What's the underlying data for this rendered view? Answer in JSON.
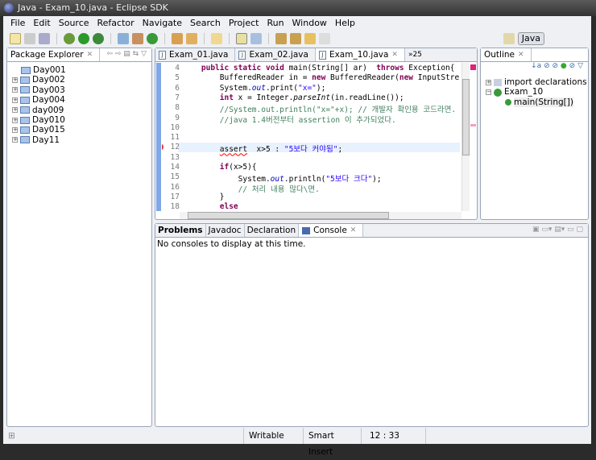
{
  "window": {
    "title": "Java - Exam_10.java - Eclipse SDK"
  },
  "menu": [
    "File",
    "Edit",
    "Source",
    "Refactor",
    "Navigate",
    "Search",
    "Project",
    "Run",
    "Window",
    "Help"
  ],
  "perspective": {
    "label": "Java"
  },
  "package_explorer": {
    "title": "Package Explorer",
    "items": [
      "Day001",
      "Day002",
      "Day003",
      "Day004",
      "day009",
      "Day010",
      "Day015",
      "Day11"
    ]
  },
  "editor": {
    "tabs": [
      "Exam_01.java",
      "Exam_02.java",
      "Exam_10.java"
    ],
    "active_tab": "Exam_10.java",
    "overflow": "»25",
    "lines": [
      {
        "n": "4",
        "html": "    <span class='kw'>public static void</span> main(String[] ar)  <span class='kw'>throws</span> Exception{"
      },
      {
        "n": "5",
        "html": "        BufferedReader in = <span class='kw'>new</span> BufferedReader(<span class='kw'>new</span> InputStre"
      },
      {
        "n": "6",
        "html": "        System.<span class='fd'>out</span>.print(<span class='st'>\"x=\"</span>);"
      },
      {
        "n": "7",
        "html": "        <span class='kw'>int</span> x = Integer.<i>parseInt</i>(in.readLine());"
      },
      {
        "n": "8",
        "html": "        <span class='cm'>//System.out.println(\"x=\"+x); // 개발자 확인용 코드라면.</span>"
      },
      {
        "n": "9",
        "html": "        <span class='cm'>//java 1.4버전부터 assertion 이 추가되었다.</span>"
      },
      {
        "n": "10",
        "html": ""
      },
      {
        "n": "11",
        "html": ""
      },
      {
        "n": "12",
        "html": "        <u style='text-decoration-color:red;text-decoration-style:wavy'>assert</u>  x&gt;5 : <span class='st'>\"5보다 커야됨\"</span>;"
      },
      {
        "n": "13",
        "html": ""
      },
      {
        "n": "14",
        "html": "        <span class='kw'>if</span>(x&gt;5){"
      },
      {
        "n": "15",
        "html": "            System.<span class='fd'>out</span>.println(<span class='st'>\"5보다 크다\"</span>);"
      },
      {
        "n": "16",
        "html": "            <span class='cm'>// 처리 내용 많다\\면.</span>"
      },
      {
        "n": "17",
        "html": "        }"
      },
      {
        "n": "18",
        "html": "        <span class='kw'>else</span>"
      }
    ]
  },
  "outline": {
    "title": "Outline",
    "items": [
      "import declarations",
      "Exam_10",
      "main(String[])"
    ]
  },
  "bottom": {
    "tabs": [
      "Problems",
      "Javadoc",
      "Declaration",
      "Console"
    ],
    "active_tab": "Console",
    "message": "No consoles to display at this time."
  },
  "status": {
    "mode": "Writable",
    "insert": "Smart Insert",
    "position": "12 : 33"
  }
}
